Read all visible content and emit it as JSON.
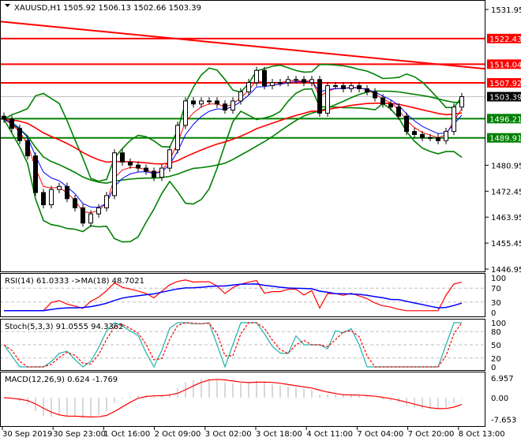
{
  "header": {
    "symbol": "XAUUSD,H1",
    "ohlc": "1505.92 1506.13 1502.66 1503.39"
  },
  "colors": {
    "up": "#000000",
    "down": "#000000",
    "bullBody": "#ffffff",
    "bearBody": "#000000",
    "red": "#ff0000",
    "green": "#008000",
    "blue": "#0000ff",
    "teal": "#20b2aa",
    "grid": "#c0c0c0"
  },
  "chart_data": {
    "type": "candlestick",
    "title": "XAUUSD,H1",
    "ylim": [
      1446.95,
      1531.95
    ],
    "price_ticks": [
      "1531.95",
      "1480.95",
      "1472.45",
      "1463.95",
      "1455.45",
      "1446.95"
    ],
    "closes": [
      1496,
      1493,
      1489,
      1484,
      1472,
      1468,
      1473,
      1474,
      1470,
      1467,
      1462,
      1465,
      1467,
      1471,
      1485,
      1482,
      1481,
      1480,
      1479,
      1477,
      1480,
      1486,
      1494,
      1502,
      1501,
      1502,
      1502,
      1501,
      1499,
      1502,
      1505,
      1508,
      1512,
      1507,
      1508,
      1508,
      1509,
      1509,
      1508,
      1509,
      1498,
      1507,
      1507,
      1506,
      1507,
      1506,
      1505,
      1503,
      1501,
      1500,
      1497,
      1492,
      1491,
      1490,
      1490,
      1489,
      1492,
      1500,
      1503.39
    ],
    "levels": [
      {
        "label": "1522.43",
        "value": 1522.43,
        "color": "red"
      },
      {
        "label": "1514.04",
        "value": 1514.04,
        "color": "red"
      },
      {
        "label": "1507.92",
        "value": 1507.92,
        "color": "red"
      },
      {
        "label": "1496.21",
        "value": 1496.21,
        "color": "green"
      },
      {
        "label": "1489.91",
        "value": 1489.91,
        "color": "green"
      }
    ],
    "current_price": {
      "label": "1503.39",
      "value": 1503.39
    },
    "trendline": {
      "from": 1528.0,
      "to": 1512.5
    },
    "x_labels": [
      "30 Sep 2019",
      "30 Sep 23:00",
      "1 Oct 16:00",
      "2 Oct 09:00",
      "3 Oct 02:00",
      "3 Oct 18:00",
      "4 Oct 11:00",
      "7 Oct 04:00",
      "7 Oct 20:00",
      "8 Oct 13:00"
    ],
    "indicators": {
      "rsi": {
        "label": "RSI(14) 61.0333  ->MA(18) 48.7021",
        "ticks": [
          "100",
          "70",
          "30",
          "0"
        ]
      },
      "stoch": {
        "label": "Stoch(5,3,3) 91.0555 94.3362",
        "ticks": [
          "100",
          "80",
          "50",
          "20",
          "0"
        ]
      },
      "macd": {
        "label": "MACD(12,26,9) 0.624 -1.769",
        "ticks": [
          "6.957",
          "0.00",
          "-7.653"
        ]
      }
    }
  }
}
